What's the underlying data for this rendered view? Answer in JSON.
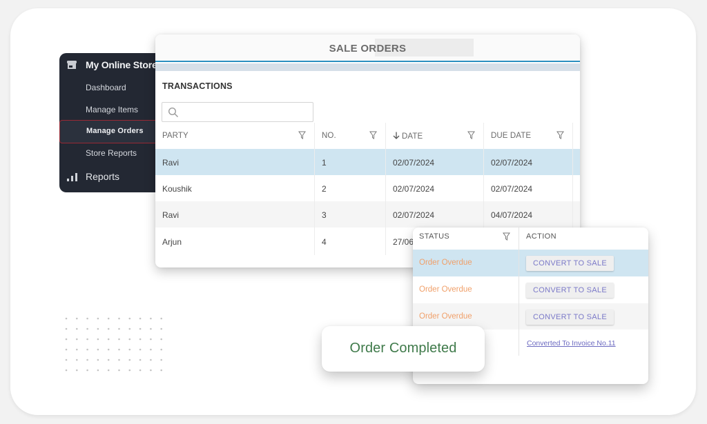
{
  "sidebar": {
    "title": "My Online Store",
    "items": [
      {
        "label": "Dashboard",
        "active": false
      },
      {
        "label": "Manage Items",
        "active": false
      },
      {
        "label": "Manage Orders",
        "active": true
      },
      {
        "label": "Store Reports",
        "active": false
      }
    ],
    "reports_label": "Reports",
    "icons": {
      "store": "store-icon",
      "reports": "bar-chart-icon"
    },
    "active_border_color": "#9a2a35"
  },
  "main": {
    "title": "SALE ORDERS",
    "section_title": "TRANSACTIONS",
    "search": {
      "value": "",
      "placeholder": ""
    },
    "columns": [
      {
        "label": "PARTY",
        "filter": true
      },
      {
        "label": "NO.",
        "filter": true
      },
      {
        "label": "DATE",
        "filter": true,
        "sort": "descending"
      },
      {
        "label": "DUE DATE",
        "filter": true
      }
    ],
    "rows": [
      {
        "party": "Ravi",
        "no": "1",
        "date": "02/07/2024",
        "due_date": "02/07/2024",
        "selected": true
      },
      {
        "party": "Koushik",
        "no": "2",
        "date": "02/07/2024",
        "due_date": "02/07/2024",
        "selected": false
      },
      {
        "party": "Ravi",
        "no": "3",
        "date": "02/07/2024",
        "due_date": "04/07/2024",
        "selected": false
      },
      {
        "party": "Arjun",
        "no": "4",
        "date": "27/06",
        "due_date": "",
        "selected": false
      }
    ],
    "accent_color": "#2b8fc0",
    "selected_row_color": "#cfe5f1"
  },
  "status_panel": {
    "columns": [
      {
        "label": "STATUS",
        "filter": true
      },
      {
        "label": "ACTION",
        "filter": false
      }
    ],
    "rows": [
      {
        "status": "Order Overdue",
        "action": "CONVERT TO SALE",
        "action_type": "button",
        "selected": true
      },
      {
        "status": "Order Overdue",
        "action": "CONVERT TO SALE",
        "action_type": "button",
        "selected": false
      },
      {
        "status": "Order Overdue",
        "action": "CONVERT TO SALE",
        "action_type": "button",
        "selected": false
      },
      {
        "status": "",
        "action": "Converted To Invoice No.11",
        "action_type": "link",
        "selected": false
      }
    ],
    "status_color": "#f0a06a",
    "action_color": "#7b79c8"
  },
  "toast": {
    "message": "Order Completed",
    "color": "#3f7a4a"
  }
}
